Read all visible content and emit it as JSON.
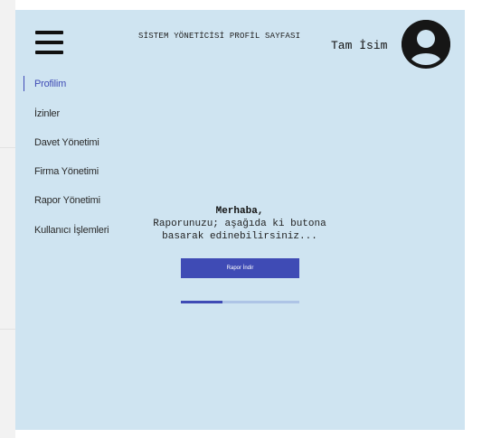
{
  "header": {
    "title": "SİSTEM YÖNETİCİSİ PROFİL SAYFASI",
    "user_name": "Tam İsim"
  },
  "icons": {
    "menu": "hamburger-menu-icon",
    "avatar": "user-avatar-icon"
  },
  "sidebar": {
    "items": [
      {
        "label": "Profilim",
        "active": true
      },
      {
        "label": "İzinler",
        "active": false
      },
      {
        "label": "Davet Yönetimi",
        "active": false
      },
      {
        "label": "Firma Yönetimi",
        "active": false
      },
      {
        "label": "Rapor Yönetimi",
        "active": false
      },
      {
        "label": "Kullanıcı İşlemleri",
        "active": false
      }
    ]
  },
  "main": {
    "greeting": "Merhaba,",
    "message_line1": "Raporunuzu; aşağıda ki butona",
    "message_line2": "basarak edinebilirsiniz...",
    "button_label": "Rapor İndir",
    "progress": 0.35
  },
  "colors": {
    "panel_background": "#cfe4f1",
    "accent": "#3f4bb5",
    "progress_track": "#aec4e6"
  }
}
